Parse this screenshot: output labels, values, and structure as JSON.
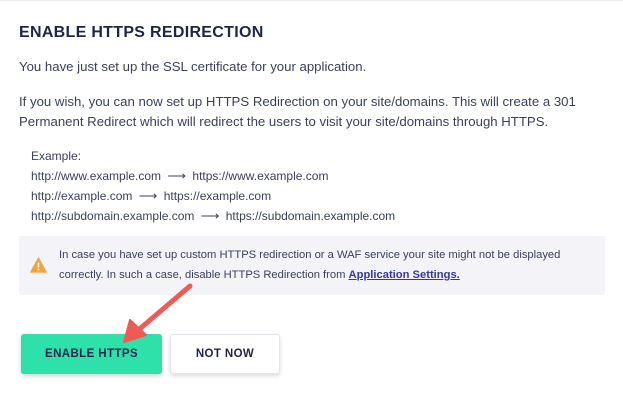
{
  "section": {
    "title": "ENABLE HTTPS REDIRECTION",
    "intro": "You have just set up the SSL certificate for your application.",
    "description": "If you wish, you can now set up HTTPS Redirection on your site/domains. This will create a 301 Permanent Redirect which will redirect the users to visit your site/domains through HTTPS."
  },
  "example": {
    "label": "Example:",
    "arrow": "⟶",
    "rows": [
      {
        "from": "http://www.example.com",
        "to": "https://www.example.com"
      },
      {
        "from": "http://example.com",
        "to": "https://example.com"
      },
      {
        "from": "http://subdomain.example.com",
        "to": "https://subdomain.example.com"
      }
    ]
  },
  "warning": {
    "icon": "warning-triangle-icon",
    "text_before": "In case you have set up custom HTTPS redirection or a WAF service your site might not be displayed correctly. In such a case, disable HTTPS Redirection from ",
    "link_label": "Application Settings.",
    "accent_color": "#f2a33a"
  },
  "actions": {
    "enable_label": "ENABLE HTTPS",
    "not_now_label": "NOT NOW",
    "primary_color": "#2ee0a9",
    "annotation_arrow_color": "#f05a55"
  }
}
